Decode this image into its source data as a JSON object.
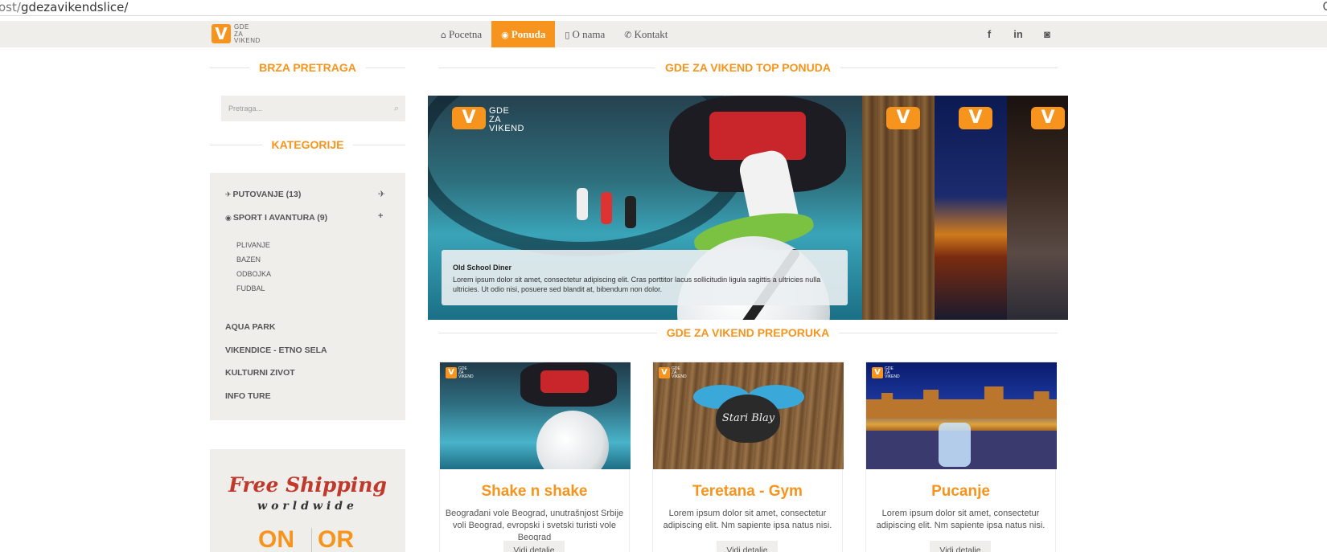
{
  "browser": {
    "url_prefix": "ost/",
    "url_path": "gdezavikendslice/",
    "reload_glyph": "C"
  },
  "header": {
    "logo": {
      "mark": "V",
      "lines": [
        "GDE",
        "ZA",
        "VIKEND"
      ]
    },
    "nav": [
      {
        "label": "Pocetna",
        "icon": "home-icon",
        "glyph": "⌂",
        "active": false
      },
      {
        "label": "Ponuda",
        "icon": "globe-icon",
        "glyph": "◉",
        "active": true
      },
      {
        "label": "O nama",
        "icon": "square-icon",
        "glyph": "▯",
        "active": false
      },
      {
        "label": "Kontakt",
        "icon": "phone-icon",
        "glyph": "✆",
        "active": false
      }
    ],
    "social": [
      {
        "icon": "facebook-icon",
        "glyph": "f"
      },
      {
        "icon": "linkedin-icon",
        "glyph": "in"
      },
      {
        "icon": "instagram-icon",
        "glyph": "◙"
      }
    ],
    "accent": "#f7941d"
  },
  "sidebar": {
    "search_title": "BRZA PRETRAGA",
    "search_placeholder": "Pretraga...",
    "categories_title": "KATEGORIJE",
    "categories": [
      {
        "label": "PUTOVANJE (13)",
        "icon": "plane-icon",
        "glyph": "✈",
        "toggle": "✈"
      },
      {
        "label": "SPORT I AVANTURA (9)",
        "icon": "globe-icon",
        "glyph": "◉",
        "toggle": "+"
      }
    ],
    "subcategories": [
      "PLIVANJE",
      "BAZEN",
      "ODBOJKA",
      "FUDBAL"
    ],
    "other_categories": [
      "AQUA PARK",
      "VIKENDICE - ETNO SELA",
      "KULTURNI ZIVOT",
      "INFO TURE"
    ],
    "promo": {
      "line1": "Free Shipping",
      "line2": "worldwide",
      "left": "ON",
      "right": "OR"
    }
  },
  "main": {
    "top_title": "GDE ZA VIKEND TOP PONUDA",
    "slider": {
      "logo_lines": [
        "GDE",
        "ZA",
        "VIKEND"
      ],
      "caption_title": "Old School Diner",
      "caption_text": "Lorem ipsum dolor sit amet, consectetur adipiscing elit. Cras porttitor lacus sollicitudin ligula sagittis a ultricies nulla ultricies. Ut odio nisi, posuere sed blandit at, bibendum non dolor."
    },
    "recommend_title": "GDE ZA VIKEND PREPORUKA",
    "cards": [
      {
        "title": "Shake n shake",
        "desc": "Beograđani vole Beograd, unutrašnjost Srbije voli Beograd, evropski i svetski turisti vole Beograd",
        "button": "Vidi detalje"
      },
      {
        "title": "Teretana - Gym",
        "desc": "Lorem ipsum dolor sit amet, consectetur adipiscing elit. Nm sapiente ipsa natus nisi.",
        "button": "Vidi detalje",
        "image_text": "Stari Blay"
      },
      {
        "title": "Pucanje",
        "desc": "Lorem ipsum dolor sit amet, consectetur adipiscing elit. Nm sapiente ipsa natus nisi.",
        "button": "Vidi detalje"
      }
    ]
  }
}
